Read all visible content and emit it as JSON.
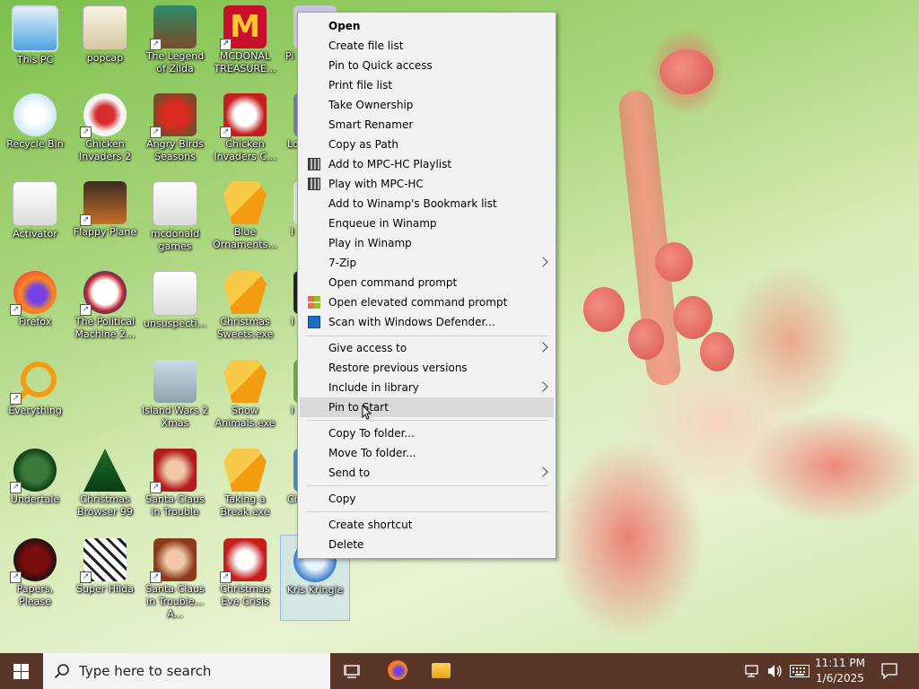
{
  "desktop_icons": [
    {
      "label": "This PC"
    },
    {
      "label": "popcap"
    },
    {
      "label": "The Legend of Zilda"
    },
    {
      "label": "MCDONAL TREASURE..."
    },
    {
      "label": "Recycle Bin"
    },
    {
      "label": "Chicken Invaders 2"
    },
    {
      "label": "Angry Birds Seasons"
    },
    {
      "label": "Chicken Invaders C..."
    },
    {
      "label": "Activator"
    },
    {
      "label": "Flappy Plane"
    },
    {
      "label": "mcdonald games"
    },
    {
      "label": "Blue Ornaments..."
    },
    {
      "label": "Firefox"
    },
    {
      "label": "The Political Machine 2..."
    },
    {
      "label": "unsuspecti..."
    },
    {
      "label": "Christmas Sweets.exe"
    },
    {
      "label": "Everything"
    },
    {
      "label": "Island Wars 2 Xmas"
    },
    {
      "label": "Snow Animals.exe"
    },
    {
      "label": "Undertale"
    },
    {
      "label": "Christmas Browser 99"
    },
    {
      "label": "Santa Claus in Trouble"
    },
    {
      "label": "Taking a Break.exe"
    },
    {
      "label": "Papers, Please"
    },
    {
      "label": "Super Hilda"
    },
    {
      "label": "Santa Claus in Trouble... A..."
    },
    {
      "label": "Christmas Eve Crisis"
    },
    {
      "label": "Kris Kringle"
    }
  ],
  "partial_labels": [
    "Pi",
    "Lo",
    "I",
    "I",
    "I",
    "I",
    "Ch"
  ],
  "context_menu": {
    "items": [
      {
        "label": "Open",
        "bold": true
      },
      {
        "label": "Create file list"
      },
      {
        "label": "Pin to Quick access"
      },
      {
        "label": "Print file list"
      },
      {
        "label": "Take Ownership"
      },
      {
        "label": "Smart Renamer"
      },
      {
        "label": "Copy as Path"
      },
      {
        "label": "Add to MPC-HC Playlist",
        "icon": "mpc-hc-icon"
      },
      {
        "label": "Play with MPC-HC",
        "icon": "mpc-hc-icon"
      },
      {
        "label": "Add to Winamp's Bookmark list"
      },
      {
        "label": "Enqueue in Winamp"
      },
      {
        "label": "Play in Winamp"
      },
      {
        "label": "7-Zip",
        "submenu": true
      },
      {
        "label": "Open command prompt"
      },
      {
        "label": "Open elevated command prompt",
        "icon": "windows-flag-icon"
      },
      {
        "label": "Scan with Windows Defender...",
        "icon": "defender-icon"
      },
      {
        "label": "Give access to",
        "submenu": true
      },
      {
        "label": "Restore previous versions"
      },
      {
        "label": "Include in library",
        "submenu": true
      },
      {
        "label": "Pin to Start",
        "highlighted": true
      },
      {
        "label": "Copy To folder..."
      },
      {
        "label": "Move To folder..."
      },
      {
        "label": "Send to",
        "submenu": true
      },
      {
        "label": "Copy"
      },
      {
        "label": "Create shortcut"
      },
      {
        "label": "Delete"
      }
    ]
  },
  "taskbar": {
    "search_placeholder": "Type here to search",
    "time": "11:11 PM",
    "date": "1/6/2025",
    "icons": [
      "windows-start-icon",
      "search-icon",
      "task-view-icon",
      "firefox-icon",
      "file-explorer-icon",
      "network-icon",
      "volume-icon",
      "keyboard-icon",
      "notification-icon"
    ]
  },
  "colors": {
    "taskbar": "#5a3628",
    "menu_bg": "#f2f2f2",
    "menu_highlight": "#d9d9d9"
  }
}
